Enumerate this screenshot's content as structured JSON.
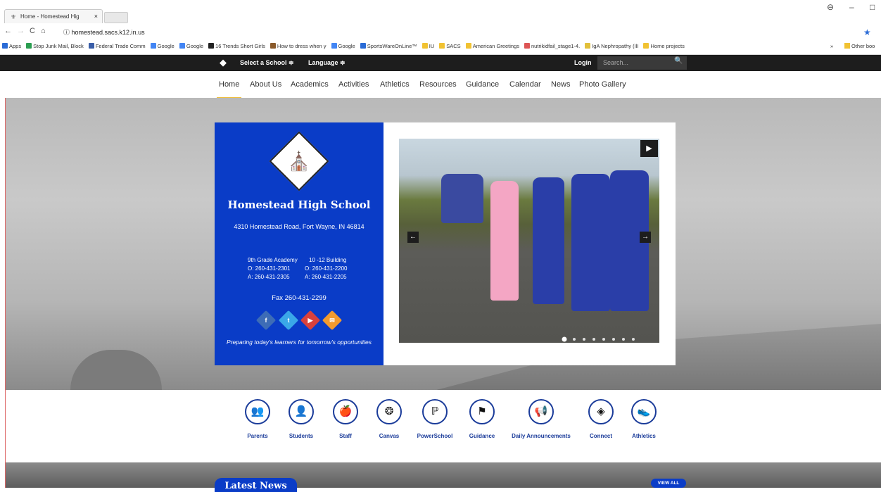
{
  "browser": {
    "tab_title": "Home - Homestead Hig",
    "url": "homestead.sacs.k12.in.us",
    "bookmarks": [
      {
        "label": "Apps",
        "color": "#2a6bd6"
      },
      {
        "label": "Stop Junk Mail, Block",
        "color": "#2b9e51"
      },
      {
        "label": "Federal Trade Comm",
        "color": "#3a5ea8"
      },
      {
        "label": "Google",
        "color": "#4285f4"
      },
      {
        "label": "Google",
        "color": "#4285f4"
      },
      {
        "label": "16 Trends Short Girls",
        "color": "#222"
      },
      {
        "label": "How to dress when y",
        "color": "#8a5a2b"
      },
      {
        "label": "Google",
        "color": "#4285f4"
      },
      {
        "label": "SportsWareOnLine™",
        "color": "#2a6bd6"
      },
      {
        "label": "IU",
        "color": "#f1c232"
      },
      {
        "label": "SACS",
        "color": "#f1c232"
      },
      {
        "label": "American Greetings",
        "color": "#f1c232"
      },
      {
        "label": "nutrikidfail_stage1-4.",
        "color": "#d55"
      },
      {
        "label": "IgA Nephropathy (IlI",
        "color": "#e2c03a"
      },
      {
        "label": "Home projects",
        "color": "#f1c232"
      }
    ],
    "more_bookmarks": "»",
    "other_bookmarks": "Other boo"
  },
  "topbar": {
    "select_school": "Select a School ≑",
    "language": "Language ≑",
    "login": "Login",
    "search_placeholder": "Search..."
  },
  "menu": [
    "Home",
    "About Us",
    "Academics",
    "Activities",
    "Athletics",
    "Resources",
    "Guidance",
    "Calendar",
    "News",
    "Photo Gallery"
  ],
  "school": {
    "name": "Homestead High School",
    "address": "4310 Homestead Road, Fort Wayne, IN 46814",
    "academy_title": "9th Grade Academy",
    "academy_o": "O: 260-431-2301",
    "academy_a": "A: 260-431-2305",
    "building_title": "10 -12 Building",
    "building_o": "O: 260-431-2200",
    "building_a": "A: 260-431-2205",
    "fax": "Fax 260-431-2299",
    "tagline": "Preparing today's learners for tomorrow's opportunities"
  },
  "social": [
    {
      "name": "facebook-icon",
      "glyph": "f",
      "color": "#3d6cb6"
    },
    {
      "name": "twitter-icon",
      "glyph": "t",
      "color": "#3aa7e8"
    },
    {
      "name": "youtube-icon",
      "glyph": "▶",
      "color": "#d9413b"
    },
    {
      "name": "email-icon",
      "glyph": "✉",
      "color": "#f29a2e"
    }
  ],
  "slideshow": {
    "total_slides": 8,
    "current": 1
  },
  "quicklinks": [
    {
      "label": "Parents",
      "icon": "parents-icon",
      "glyph": "👥"
    },
    {
      "label": "Students",
      "icon": "students-icon",
      "glyph": "👤"
    },
    {
      "label": "Staff",
      "icon": "staff-icon",
      "glyph": "🍎"
    },
    {
      "label": "Canvas",
      "icon": "canvas-icon",
      "glyph": "❂"
    },
    {
      "label": "PowerSchool",
      "icon": "powerschool-icon",
      "glyph": "ℙ"
    },
    {
      "label": "Guidance",
      "icon": "guidance-icon",
      "glyph": "⚑"
    },
    {
      "label": "Daily Announcements",
      "icon": "megaphone-icon",
      "glyph": "📢"
    },
    {
      "label": "Connect",
      "icon": "connect-icon",
      "glyph": "◈"
    },
    {
      "label": "Athletics",
      "icon": "athletics-icon",
      "glyph": "👟"
    }
  ],
  "news": {
    "title": "Latest News",
    "view_all": "VIEW ALL"
  }
}
